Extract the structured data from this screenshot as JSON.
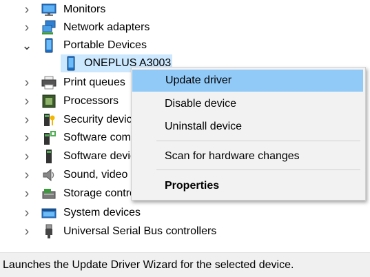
{
  "tree": {
    "items": [
      {
        "label": "Monitors",
        "icon": "monitor-icon",
        "state": "collapsed"
      },
      {
        "label": "Network adapters",
        "icon": "network-adapter-icon",
        "state": "collapsed"
      },
      {
        "label": "Portable Devices",
        "icon": "portable-device-icon",
        "state": "expanded"
      },
      {
        "label": "ONEPLUS A3003",
        "icon": "phone-icon",
        "state": "child-selected"
      },
      {
        "label": "Print queues",
        "icon": "printer-icon",
        "state": "collapsed"
      },
      {
        "label": "Processors",
        "icon": "processor-icon",
        "state": "collapsed"
      },
      {
        "label": "Security devices",
        "icon": "security-device-icon",
        "state": "collapsed"
      },
      {
        "label": "Software components",
        "icon": "software-component-icon",
        "state": "collapsed"
      },
      {
        "label": "Software devices",
        "icon": "software-device-icon",
        "state": "collapsed"
      },
      {
        "label": "Sound, video and game controllers",
        "icon": "sound-icon",
        "state": "collapsed"
      },
      {
        "label": "Storage controllers",
        "icon": "storage-controller-icon",
        "state": "collapsed"
      },
      {
        "label": "System devices",
        "icon": "system-device-icon",
        "state": "collapsed"
      },
      {
        "label": "Universal Serial Bus controllers",
        "icon": "usb-icon",
        "state": "collapsed"
      }
    ]
  },
  "context_menu": {
    "update_driver": "Update driver",
    "disable_device": "Disable device",
    "uninstall_device": "Uninstall device",
    "scan_hardware": "Scan for hardware changes",
    "properties": "Properties"
  },
  "status_bar": {
    "text": "Launches the Update Driver Wizard for the selected device."
  },
  "colors": {
    "menu_hover": "#91c9f7",
    "selection": "#cce8ff",
    "menu_background": "#f2f2f2"
  }
}
